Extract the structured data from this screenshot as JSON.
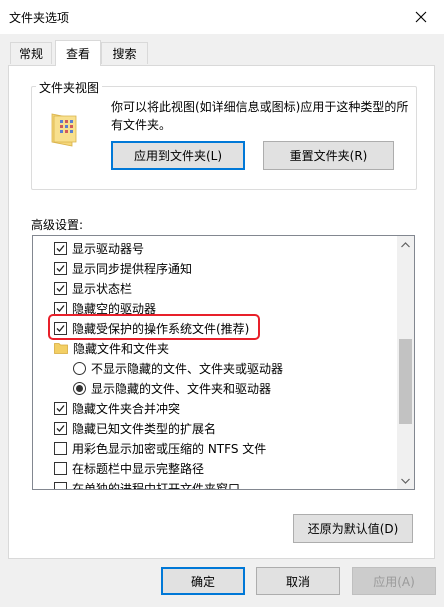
{
  "window": {
    "title": "文件夹选项"
  },
  "tabs": [
    {
      "label": "常规",
      "active": false
    },
    {
      "label": "查看",
      "active": true
    },
    {
      "label": "搜索",
      "active": false
    }
  ],
  "folder_views": {
    "legend": "文件夹视图",
    "description": "你可以将此视图(如详细信息或图标)应用于这种类型的所有文件夹。",
    "apply_button": "应用到文件夹(L)",
    "reset_button": "重置文件夹(R)"
  },
  "advanced": {
    "label": "高级设置:",
    "items": [
      {
        "type": "checkbox",
        "checked": true,
        "label": "显示驱动器号"
      },
      {
        "type": "checkbox",
        "checked": true,
        "label": "显示同步提供程序通知"
      },
      {
        "type": "checkbox",
        "checked": true,
        "label": "显示状态栏"
      },
      {
        "type": "checkbox",
        "checked": true,
        "label": "隐藏空的驱动器"
      },
      {
        "type": "checkbox",
        "checked": true,
        "label": "隐藏受保护的操作系统文件(推荐)"
      },
      {
        "type": "folder",
        "label": "隐藏文件和文件夹"
      },
      {
        "type": "radio",
        "checked": false,
        "label": "不显示隐藏的文件、文件夹或驱动器"
      },
      {
        "type": "radio",
        "checked": true,
        "label": "显示隐藏的文件、文件夹和驱动器"
      },
      {
        "type": "checkbox",
        "checked": true,
        "label": "隐藏文件夹合并冲突"
      },
      {
        "type": "checkbox",
        "checked": true,
        "label": "隐藏已知文件类型的扩展名"
      },
      {
        "type": "checkbox",
        "checked": false,
        "label": "用彩色显示加密或压缩的 NTFS 文件"
      },
      {
        "type": "checkbox",
        "checked": false,
        "label": "在标题栏中显示完整路径"
      },
      {
        "type": "checkbox",
        "checked": false,
        "label": "在单独的进程中打开文件夹窗口"
      }
    ],
    "restore_button": "还原为默认值(D)"
  },
  "footer": {
    "ok_button": "确定",
    "cancel_button": "取消",
    "apply_button": "应用(A)"
  },
  "highlight_color": "#e8202a",
  "accent_color": "#0078d7"
}
